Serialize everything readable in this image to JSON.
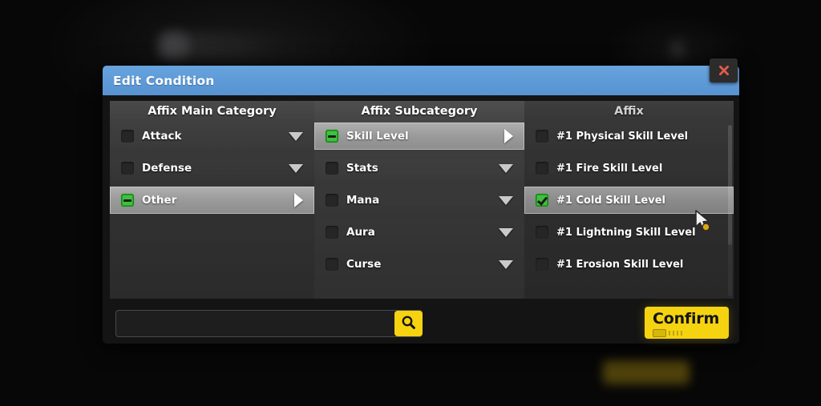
{
  "dialog": {
    "title": "Edit Condition",
    "close_icon": "close-x-icon"
  },
  "columns": {
    "main": {
      "header": "Affix Main Category",
      "items": [
        {
          "label": "Attack",
          "checkbox": "unchecked",
          "arrow": "chevron-down-icon",
          "selected": false
        },
        {
          "label": "Defense",
          "checkbox": "unchecked",
          "arrow": "chevron-down-icon",
          "selected": false
        },
        {
          "label": "Other",
          "checkbox": "indeterminate",
          "arrow": "chevron-right-icon",
          "selected": true
        }
      ]
    },
    "sub": {
      "header": "Affix Subcategory",
      "items": [
        {
          "label": "Skill Level",
          "checkbox": "indeterminate",
          "arrow": "chevron-right-icon",
          "selected": true
        },
        {
          "label": "Stats",
          "checkbox": "unchecked",
          "arrow": "chevron-down-icon",
          "selected": false
        },
        {
          "label": "Mana",
          "checkbox": "unchecked",
          "arrow": "chevron-down-icon",
          "selected": false
        },
        {
          "label": "Aura",
          "checkbox": "unchecked",
          "arrow": "chevron-down-icon",
          "selected": false
        },
        {
          "label": "Curse",
          "checkbox": "unchecked",
          "arrow": "chevron-down-icon",
          "selected": false
        }
      ]
    },
    "affix": {
      "header": "Affix",
      "items": [
        {
          "label": "#1 Physical Skill Level",
          "checkbox": "unchecked",
          "selected": false
        },
        {
          "label": "#1 Fire Skill Level",
          "checkbox": "unchecked",
          "selected": false
        },
        {
          "label": "#1 Cold Skill Level",
          "checkbox": "checked",
          "selected": true
        },
        {
          "label": "#1 Lightning Skill Level",
          "checkbox": "unchecked",
          "selected": false
        },
        {
          "label": "#1 Erosion Skill Level",
          "checkbox": "unchecked",
          "selected": false
        }
      ]
    }
  },
  "search": {
    "value": "",
    "placeholder": "",
    "button_icon": "search-magnifier-icon"
  },
  "confirm": {
    "label": "Confirm"
  },
  "cursor": {
    "icon": "mouse-pointer-icon"
  },
  "colors": {
    "titlebar_blue": "#5e9ad6",
    "accent_yellow": "#f5d310",
    "checkbox_green": "#3fc03f",
    "close_red": "#e05c4a",
    "panel_gray": "#3a3a3a",
    "selected_gray": "#9a9a9a"
  }
}
